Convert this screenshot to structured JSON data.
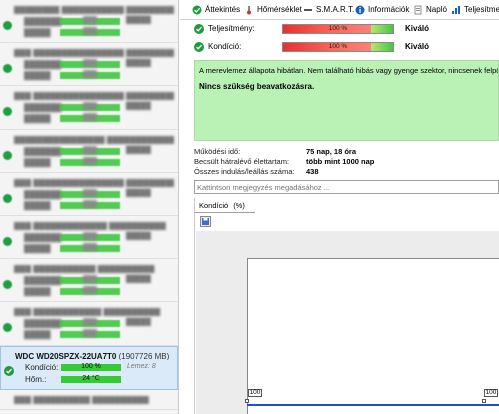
{
  "tabs": [
    {
      "label": "Áttekintés",
      "icon": "check-circle-icon"
    },
    {
      "label": "Hőmérséklet",
      "icon": "thermometer-icon"
    },
    {
      "label": "S.M.A.R.T.",
      "icon": "smart-icon"
    },
    {
      "label": "Információk",
      "icon": "info-icon"
    },
    {
      "label": "Napló",
      "icon": "log-icon"
    },
    {
      "label": "Teljesítme",
      "icon": "performance-icon"
    }
  ],
  "status": {
    "performance": {
      "label": "Teljesítmény:",
      "value": "100 %",
      "rating": "Kiváló"
    },
    "condition": {
      "label": "Kondíció:",
      "value": "100 %",
      "rating": "Kiváló"
    }
  },
  "message": {
    "line1": "A merevlemez állapota hibátlan. Nem található hibás vagy gyenge szektor, nincsenek felpörgé",
    "line2": "Nincs szükség beavatkozásra."
  },
  "details": [
    {
      "key": "Működési idő:",
      "value": "75 nap, 18 óra"
    },
    {
      "key": "Becsült hátralévő élettartam:",
      "value": "több mint 1000 nap"
    },
    {
      "key": "Összes indulás/leállás száma:",
      "value": "438"
    }
  ],
  "note": {
    "placeholder": "Kattintson megjegyzés megadásához ..."
  },
  "chart_tab": {
    "label": "Kondíció",
    "unit": "(%)"
  },
  "selected_disk": {
    "name": "WDC WD20SPZX-22UA7T0",
    "size": "(1907726 MB)",
    "condition_label": "Kondíció:",
    "condition_value": "100 %",
    "extra": "Lemez: 8",
    "temp_label": "Hőm.:",
    "temp_value": "24 °C"
  },
  "chart_data": {
    "type": "line",
    "title": "",
    "xlabel": "",
    "ylabel": "",
    "series": [
      {
        "values": [
          100,
          100
        ]
      }
    ],
    "point_labels": [
      "100",
      "100"
    ]
  }
}
